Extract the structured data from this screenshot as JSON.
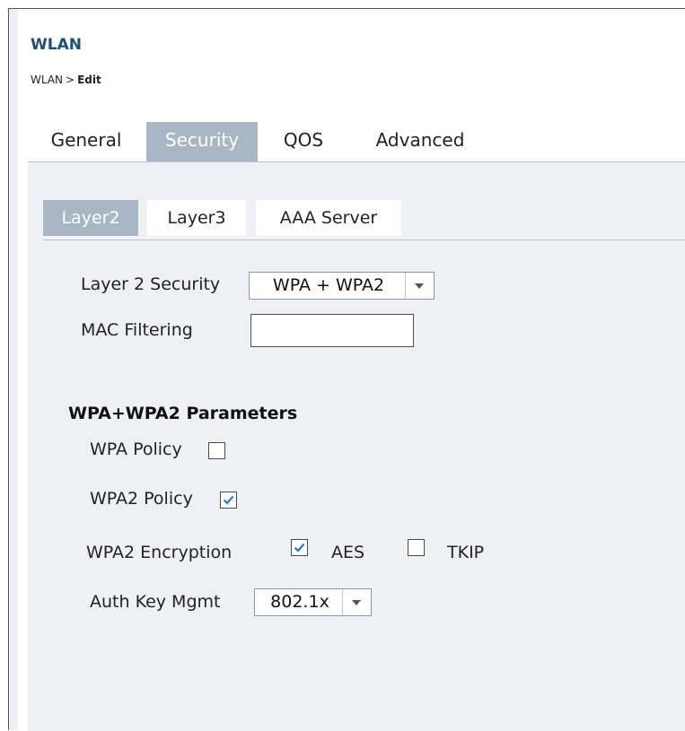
{
  "page": {
    "title": "WLAN"
  },
  "breadcrumb": {
    "parent": "WLAN",
    "separator": ">",
    "current": "Edit"
  },
  "tabs": [
    {
      "label": "General",
      "active": false
    },
    {
      "label": "Security",
      "active": true
    },
    {
      "label": "QOS",
      "active": false
    },
    {
      "label": "Advanced",
      "active": false
    }
  ],
  "subtabs": [
    {
      "label": "Layer2",
      "active": true
    },
    {
      "label": "Layer3",
      "active": false
    },
    {
      "label": "AAA Server",
      "active": false
    }
  ],
  "form": {
    "layer2_security": {
      "label": "Layer 2 Security",
      "value": "WPA + WPA2"
    },
    "mac_filtering": {
      "label": "MAC Filtering",
      "value": ""
    }
  },
  "wpa_params": {
    "title": "WPA+WPA2 Parameters",
    "wpa_policy": {
      "label": "WPA Policy",
      "checked": false
    },
    "wpa2_policy": {
      "label": "WPA2 Policy",
      "checked": true
    },
    "wpa2_encryption": {
      "label": "WPA2 Encryption",
      "aes": {
        "label": "AES",
        "checked": true
      },
      "tkip": {
        "label": "TKIP",
        "checked": false
      }
    },
    "auth_key_mgmt": {
      "label": "Auth Key Mgmt",
      "value": "802.1x"
    }
  },
  "colors": {
    "accent": "#a9b7c4",
    "title": "#1f4e79",
    "panel": "#eef0f3",
    "check": "#1e7fc8"
  },
  "icons": {
    "dropdown": "chevron-down-icon",
    "checkmark": "checkmark-icon"
  }
}
